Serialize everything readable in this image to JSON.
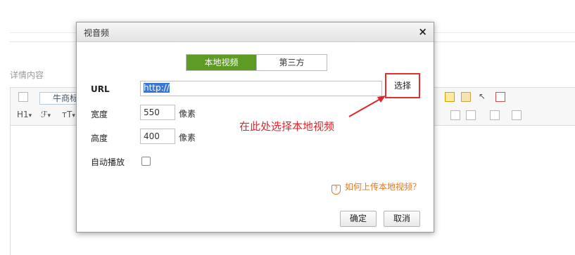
{
  "background": {
    "section_label": "详情内容",
    "toolbar": {
      "font_select": "牛商标",
      "heading": "H1",
      "font_family_icon": "font-family-icon",
      "font_size_icon": "font-size-icon"
    }
  },
  "dialog": {
    "title": "视音频",
    "close_symbol": "×",
    "tabs": [
      {
        "label": "本地视频",
        "active": true
      },
      {
        "label": "第三方",
        "active": false
      }
    ],
    "url": {
      "label": "URL",
      "value": "http://",
      "choose_button": "选择"
    },
    "width": {
      "label": "宽度",
      "value": "550",
      "unit": "像素"
    },
    "height": {
      "label": "高度",
      "value": "400",
      "unit": "像素"
    },
    "autoplay": {
      "label": "自动播放",
      "checked": false
    },
    "help_link": "如何上传本地视频？",
    "confirm_button": "确定",
    "cancel_button": "取消"
  },
  "annotation": {
    "text": "在此处选择本地视频",
    "color": "#e0262a"
  },
  "colors": {
    "active_tab": "#5e9b25",
    "help_link": "#e0782a",
    "highlight_border": "#e23030"
  }
}
